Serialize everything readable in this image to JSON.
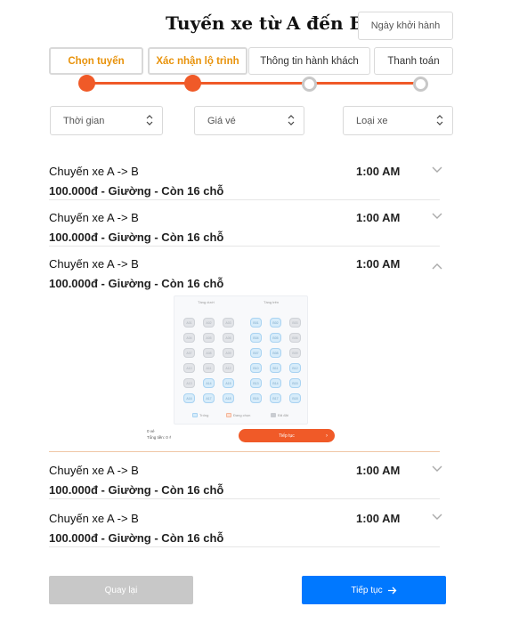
{
  "header": {
    "title": "Tuyến xe từ A đến B",
    "date_button": "Ngày khởi hành"
  },
  "steps": [
    {
      "label": "Chọn tuyến",
      "done": true
    },
    {
      "label": "Xác nhận lộ trình",
      "done": true
    },
    {
      "label": "Thông tin hành khách",
      "done": false
    },
    {
      "label": "Thanh toán",
      "done": false
    }
  ],
  "filters": [
    {
      "label": "Thời gian",
      "icon": "sort-icon"
    },
    {
      "label": "Giá vé",
      "icon": "sort-icon"
    },
    {
      "label": "Loại xe",
      "icon": "sort-icon"
    }
  ],
  "trips": [
    {
      "route": "Chuyến xe A -> B",
      "time": "1:00 AM",
      "info": "100.000đ - Giường - Còn 16 chỗ",
      "expanded": false
    },
    {
      "route": "Chuyến xe A -> B",
      "time": "1:00 AM",
      "info": "100.000đ - Giường - Còn 16 chỗ",
      "expanded": false
    },
    {
      "route": "Chuyến xe A -> B",
      "time": "1:00 AM",
      "info": "100.000đ - Giường - Còn 16 chỗ",
      "expanded": true
    },
    {
      "route": "Chuyến xe A -> B",
      "time": "1:00 AM",
      "info": "100.000đ - Giường - Còn 16 chỗ",
      "expanded": false
    },
    {
      "route": "Chuyến xe A -> B",
      "time": "1:00 AM",
      "info": "100.000đ - Giường - Còn 16 chỗ",
      "expanded": false
    }
  ],
  "seatmap": {
    "lower_label": "Tầng dưới",
    "upper_label": "Tầng trên",
    "lower_seats": [
      "A01",
      "A02",
      "A03",
      "A04",
      "A05",
      "A06",
      "A07",
      "A08",
      "A09",
      "A10",
      "A11",
      "A12",
      "A13",
      "A14",
      "A15",
      "A16",
      "A17",
      "A18"
    ],
    "upper_seats": [
      "B01",
      "B02",
      "B03",
      "B04",
      "B05",
      "B06",
      "B07",
      "B08",
      "B09",
      "B10",
      "B11",
      "B12",
      "B13",
      "B14",
      "B15",
      "B16",
      "B17",
      "B18"
    ],
    "legend": [
      "Trống",
      "Đang chọn",
      "Đã đặt"
    ],
    "summary_seats": "0 vé",
    "summary_total": "Tổng tiền: 0 ₫",
    "continue_label": "Tiếp tục"
  },
  "footer": {
    "back_label": "Quay lại",
    "next_label": "Tiếp tục"
  },
  "colors": {
    "accent": "#f05a28",
    "step_active_text": "#e8920a",
    "primary": "#0078ff",
    "disabled": "#c8c8c8"
  }
}
